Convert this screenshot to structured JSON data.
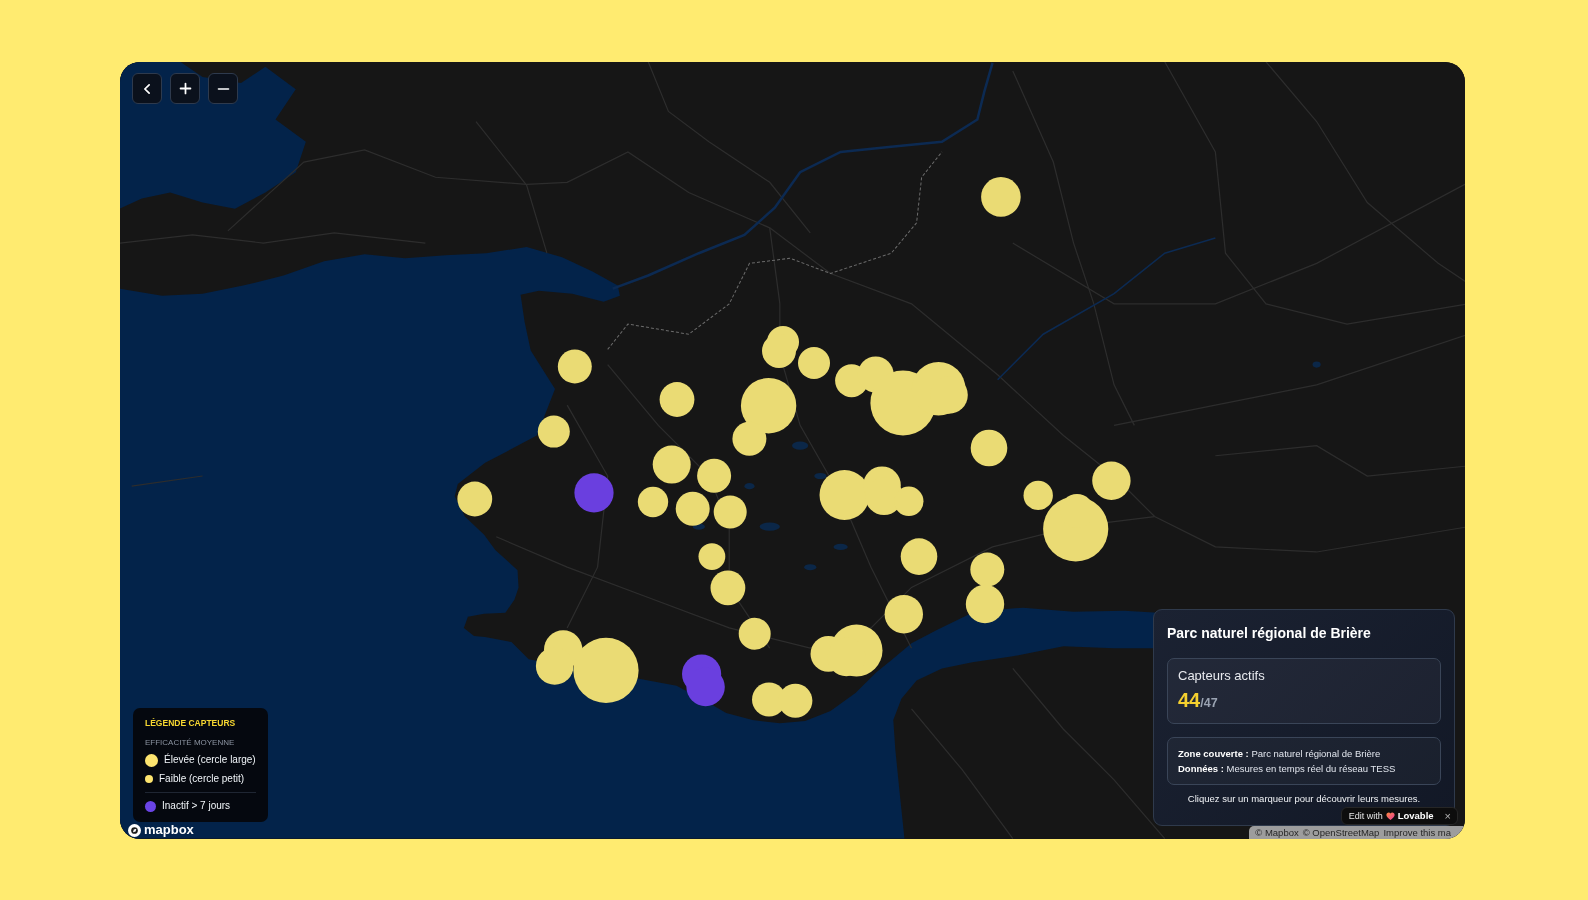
{
  "map_controls": [
    {
      "kind": "back"
    },
    {
      "kind": "zoom_in"
    },
    {
      "kind": "zoom_out"
    }
  ],
  "markers": [
    {
      "color": "#eadb74"
    },
    {
      "color": "#eadb74"
    },
    {
      "color": "#eadb74"
    },
    {
      "color": "#eadb74"
    },
    {
      "color": "#eadb74"
    },
    {
      "color": "#eadb74"
    },
    {
      "color": "#eadb74"
    },
    {
      "color": "#eadb74"
    },
    {
      "color": "#eadb74"
    },
    {
      "color": "#eadb74"
    },
    {
      "color": "#eadb74"
    },
    {
      "color": "#eadb74"
    },
    {
      "color": "#eadb74"
    },
    {
      "color": "#eadb74"
    },
    {
      "color": "#6a3fdf"
    },
    {
      "color": "#eadb74"
    },
    {
      "color": "#eadb74"
    },
    {
      "color": "#eadb74"
    },
    {
      "color": "#eadb74"
    },
    {
      "color": "#eadb74"
    },
    {
      "color": "#eadb74"
    },
    {
      "color": "#eadb74"
    },
    {
      "color": "#eadb74"
    },
    {
      "color": "#eadb74"
    },
    {
      "color": "#eadb74"
    },
    {
      "color": "#eadb74"
    },
    {
      "color": "#eadb74"
    },
    {
      "color": "#eadb74"
    },
    {
      "color": "#eadb74"
    },
    {
      "color": "#eadb74"
    },
    {
      "color": "#eadb74"
    },
    {
      "color": "#eadb74"
    },
    {
      "color": "#eadb74"
    },
    {
      "color": "#eadb74"
    },
    {
      "color": "#eadb74"
    },
    {
      "color": "#eadb74"
    },
    {
      "color": "#eadb74"
    },
    {
      "color": "#eadb74"
    },
    {
      "color": "#eadb74"
    },
    {
      "color": "#6a3fdf"
    },
    {
      "color": "#6a3fdf"
    },
    {
      "color": "#eadb74"
    },
    {
      "color": "#eadb74"
    },
    {
      "color": "#eadb74"
    },
    {
      "color": "#eadb74"
    },
    {
      "color": "#eadb74"
    },
    {
      "color": "#eadb74"
    }
  ],
  "legend": {
    "title": "LÉGENDE CAPTEURS",
    "subtitle": "EFFICACITÉ MOYENNE",
    "items": [
      {
        "kind": "large",
        "color": "#fde46f",
        "label": "Élevée (cercle large)"
      },
      {
        "kind": "small",
        "color": "#fde46f",
        "label": "Faible (cercle petit)"
      },
      {
        "kind": "inactive",
        "color": "#6a44e6",
        "label": "Inactif > 7 jours"
      }
    ]
  },
  "map_logo": {
    "text": "mapbox"
  },
  "info_panel": {
    "title": "Parc naturel régional de Brière",
    "stat": {
      "label": "Capteurs actifs",
      "value": "44",
      "total": "/47"
    },
    "details": [
      "**Zone couverte :** Parc naturel régional de Brière",
      "**Données :** Mesures en temps réel du réseau TESS"
    ],
    "hint": "Cliquez sur un marqueur pour découvrir leurs mesures."
  },
  "attribution": [
    "© Mapbox",
    "© OpenStreetMap",
    "Improve this ma"
  ],
  "edit_badge": {
    "prefix": "Edit with",
    "brand": "Lovable",
    "close": "×"
  }
}
